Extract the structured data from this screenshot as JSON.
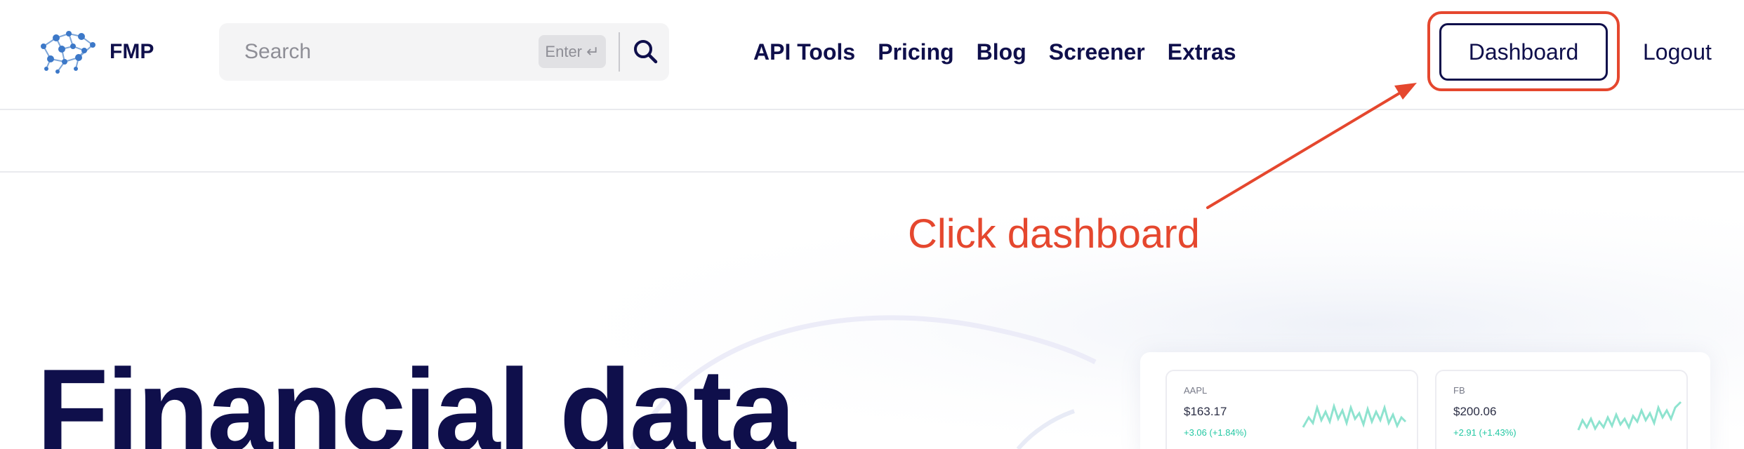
{
  "header": {
    "logo_text": "FMP",
    "search": {
      "placeholder": "Search",
      "enter_label": "Enter ↵"
    },
    "nav": [
      "API Tools",
      "Pricing",
      "Blog",
      "Screener",
      "Extras"
    ],
    "dashboard_label": "Dashboard",
    "logout_label": "Logout"
  },
  "annotation": {
    "text": "Click dashboard",
    "color": "#e5472e"
  },
  "hero": {
    "title": "Financial data"
  },
  "tickers": [
    {
      "symbol": "AAPL",
      "price": "$163.17",
      "change": "+3.06 (+1.84%)"
    },
    {
      "symbol": "FB",
      "price": "$200.06",
      "change": "+2.91 (+1.43%)"
    }
  ],
  "colors": {
    "brand_navy": "#0f0f4b",
    "positive": "#24c8a3",
    "annotation_red": "#e5472e"
  }
}
